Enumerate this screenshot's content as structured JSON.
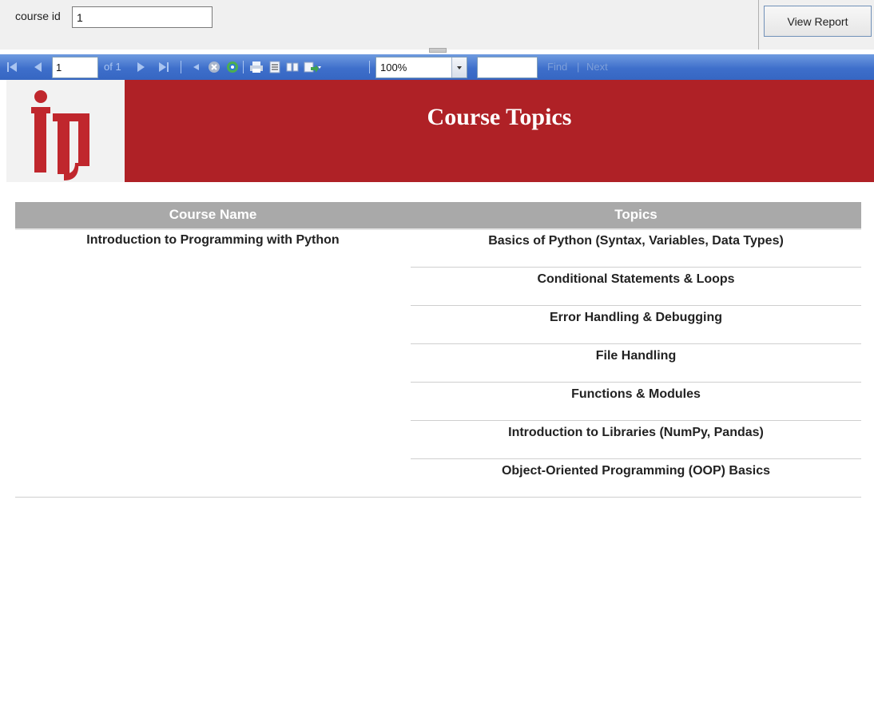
{
  "parameters": {
    "label": "course id",
    "value": "1",
    "view_report_label": "View Report"
  },
  "toolbar": {
    "page_value": "1",
    "of_pages": "of 1",
    "zoom": "100%",
    "find_value": "",
    "find_label": "Find",
    "separator": "|",
    "next_label": "Next",
    "toolbar_color": "#3e6fcb"
  },
  "report": {
    "title": "Course Topics",
    "banner_color": "#af2126",
    "header_color": "#a9a9a9",
    "columns": [
      "Course Name",
      "Topics"
    ],
    "course_name": "Introduction to Programming with Python",
    "topics": [
      "Basics of Python (Syntax, Variables, Data Types)",
      "Conditional Statements & Loops",
      "Error Handling & Debugging",
      "File Handling",
      "Functions & Modules",
      "Introduction to Libraries (NumPy, Pandas)",
      "Object-Oriented Programming (OOP) Basics"
    ],
    "logo_icon": "iti-logo-icon"
  }
}
